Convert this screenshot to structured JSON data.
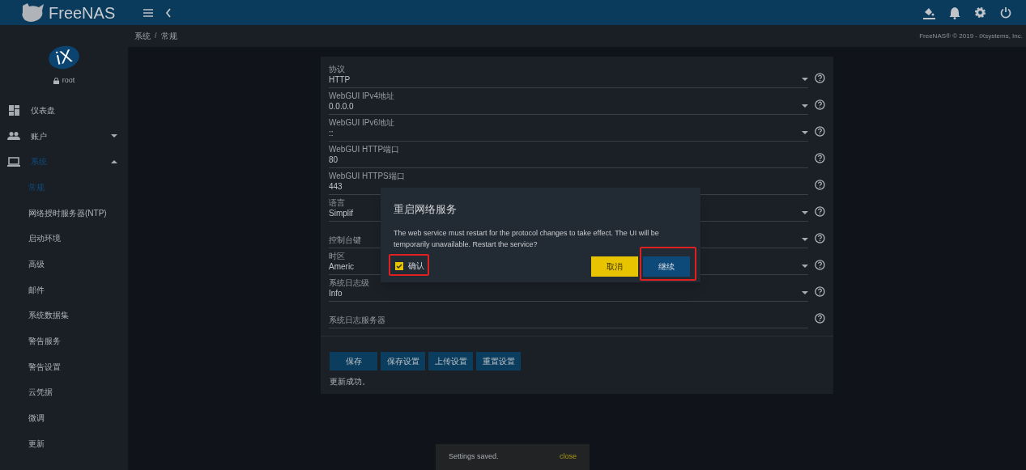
{
  "top_bar": {
    "brand": "FreeNAS"
  },
  "sidebar": {
    "org_logo": "iX",
    "user": "root",
    "items": [
      {
        "label": "仪表盘",
        "selected": false
      },
      {
        "label": "账户",
        "selected": false,
        "expanded": false
      },
      {
        "label": "系统",
        "selected": true,
        "expanded": true,
        "children": [
          {
            "label": "常规",
            "selected": true
          },
          {
            "label": "网络授时服务器(NTP)",
            "selected": false
          },
          {
            "label": "启动环境",
            "selected": false
          },
          {
            "label": "高级",
            "selected": false
          },
          {
            "label": "邮件",
            "selected": false
          },
          {
            "label": "系统数据集",
            "selected": false
          },
          {
            "label": "警告服务",
            "selected": false
          },
          {
            "label": "警告设置",
            "selected": false
          },
          {
            "label": "云凭据",
            "selected": false
          },
          {
            "label": "微调",
            "selected": false
          },
          {
            "label": "更新",
            "selected": false
          }
        ]
      }
    ]
  },
  "breadcrumb": [
    "系统",
    "常规"
  ],
  "breadcrumb_separator": "/",
  "copyright": "FreeNAS® © 2019 - iXsystems, Inc.",
  "form": {
    "fields": [
      {
        "kind": "select",
        "label": "协议",
        "value": "HTTP"
      },
      {
        "kind": "select",
        "label": "WebGUI IPv4地址",
        "value": "0.0.0.0"
      },
      {
        "kind": "select",
        "label": "WebGUI IPv6地址",
        "value": "::"
      },
      {
        "kind": "input",
        "label": "WebGUI HTTP端口",
        "value": "80"
      },
      {
        "kind": "input",
        "label": "WebGUI HTTPS端口",
        "value": "443"
      },
      {
        "kind": "select",
        "label": "语言",
        "value": "Simplif"
      },
      {
        "kind": "select",
        "placeholder": "控制台键"
      },
      {
        "kind": "select",
        "label": "时区",
        "value": "Americ"
      },
      {
        "kind": "select",
        "label": "系统日志级",
        "value": "Info"
      },
      {
        "kind": "input",
        "placeholder": "系统日志服务器"
      }
    ],
    "buttons": [
      "保存",
      "保存设置",
      "上传设置",
      "重置设置"
    ],
    "status": "更新成功。"
  },
  "dialog": {
    "title": "重启网络服务",
    "message": "The web service must restart for the protocol changes to take effect. The UI will be temporarily unavailable. Restart the service?",
    "checkbox": {
      "label": "确认",
      "checked": true,
      "highlighted": true
    },
    "buttons": [
      {
        "kind": "cancel",
        "label": "取消",
        "highlighted": false
      },
      {
        "kind": "confirm",
        "label": "继续",
        "highlighted": true
      }
    ]
  },
  "snackbar": {
    "message": "Settings saved.",
    "action": "close"
  }
}
